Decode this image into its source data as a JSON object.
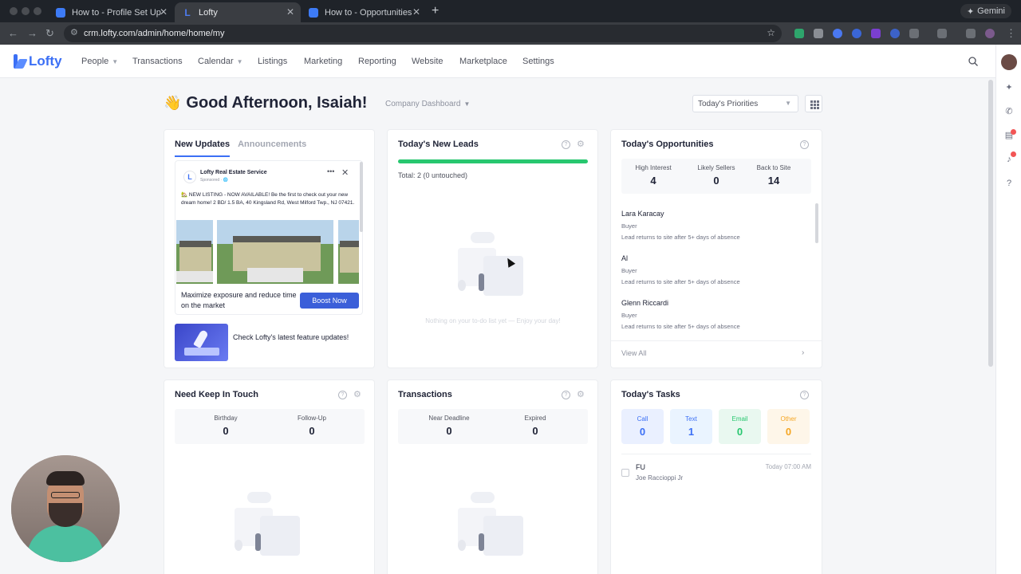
{
  "browser": {
    "tabs": [
      {
        "label": "How to - Profile Set Up",
        "active": false
      },
      {
        "label": "Lofty",
        "active": true
      },
      {
        "label": "How to - Opportunities",
        "active": false
      }
    ],
    "new_tab": "+",
    "gemini_label": "Gemini",
    "url": "crm.lofty.com/admin/home/home/my"
  },
  "app": {
    "logo": "Lofty",
    "brand_color": "#3b6ff5",
    "nav": [
      {
        "label": "People",
        "dropdown": true
      },
      {
        "label": "Transactions",
        "dropdown": false
      },
      {
        "label": "Calendar",
        "dropdown": true
      },
      {
        "label": "Listings",
        "dropdown": false
      },
      {
        "label": "Marketing",
        "dropdown": false
      },
      {
        "label": "Reporting",
        "dropdown": false
      },
      {
        "label": "Website",
        "dropdown": false
      },
      {
        "label": "Marketplace",
        "dropdown": false
      },
      {
        "label": "Settings",
        "dropdown": false
      }
    ]
  },
  "header": {
    "wave": "👋",
    "greeting": "Good Afternoon, Isaiah!",
    "dashboard_select": "Company Dashboard",
    "priorities_select": "Today's Priorities"
  },
  "updates": {
    "tab_active": "New Updates",
    "tab_inactive": "Announcements",
    "ad": {
      "advertiser": "Lofty Real Estate Service",
      "sponsored": "Sponsored · 🌐",
      "text": "🏡 NEW LISTING - NOW AVAILABLE! Be the first to check out your new dream home! 2 BD/ 1.5 BA, 40 Kingsland Rd, West Milford Twp., NJ 07421.",
      "message": "Maximize exposure and reduce time on the market",
      "boost_label": "Boost Now"
    },
    "feature_text": "Check Lofty's latest feature updates!"
  },
  "leads": {
    "title": "Today's New Leads",
    "progress": 1.0,
    "total": "Total: 2 (0 untouched)",
    "empty_text": "Nothing on your to-do list yet — Enjoy your day!"
  },
  "opportunities": {
    "title": "Today's Opportunities",
    "stats": [
      {
        "label": "High Interest",
        "value": "4"
      },
      {
        "label": "Likely Sellers",
        "value": "0"
      },
      {
        "label": "Back to Site",
        "value": "14"
      }
    ],
    "items": [
      {
        "name": "Lara Karacay",
        "type": "Buyer",
        "desc": "Lead returns to site after 5+ days of absence"
      },
      {
        "name": "Al",
        "type": "Buyer",
        "desc": "Lead returns to site after 5+ days of absence"
      },
      {
        "name": "Glenn Riccardi",
        "type": "Buyer",
        "desc": "Lead returns to site after 5+ days of absence"
      }
    ],
    "view_all": "View All"
  },
  "keep_in_touch": {
    "title": "Need Keep In Touch",
    "stats": [
      {
        "label": "Birthday",
        "value": "0"
      },
      {
        "label": "Follow-Up",
        "value": "0"
      }
    ]
  },
  "transactions": {
    "title": "Transactions",
    "stats": [
      {
        "label": "Near Deadline",
        "value": "0"
      },
      {
        "label": "Expired",
        "value": "0"
      }
    ]
  },
  "tasks": {
    "title": "Today's Tasks",
    "types": [
      {
        "label": "Call",
        "value": "0",
        "color": "#3b6ff5",
        "bg": "#eaf0ff"
      },
      {
        "label": "Text",
        "value": "1",
        "color": "#3b6ff5",
        "bg": "#eaf4ff"
      },
      {
        "label": "Email",
        "value": "0",
        "color": "#28c76f",
        "bg": "#e9f8f0"
      },
      {
        "label": "Other",
        "value": "0",
        "color": "#f5a623",
        "bg": "#fef6e9"
      }
    ],
    "items": [
      {
        "name": "FU",
        "person": "Joe Raccioppi Jr",
        "time": "Today 07:00 AM"
      }
    ]
  }
}
